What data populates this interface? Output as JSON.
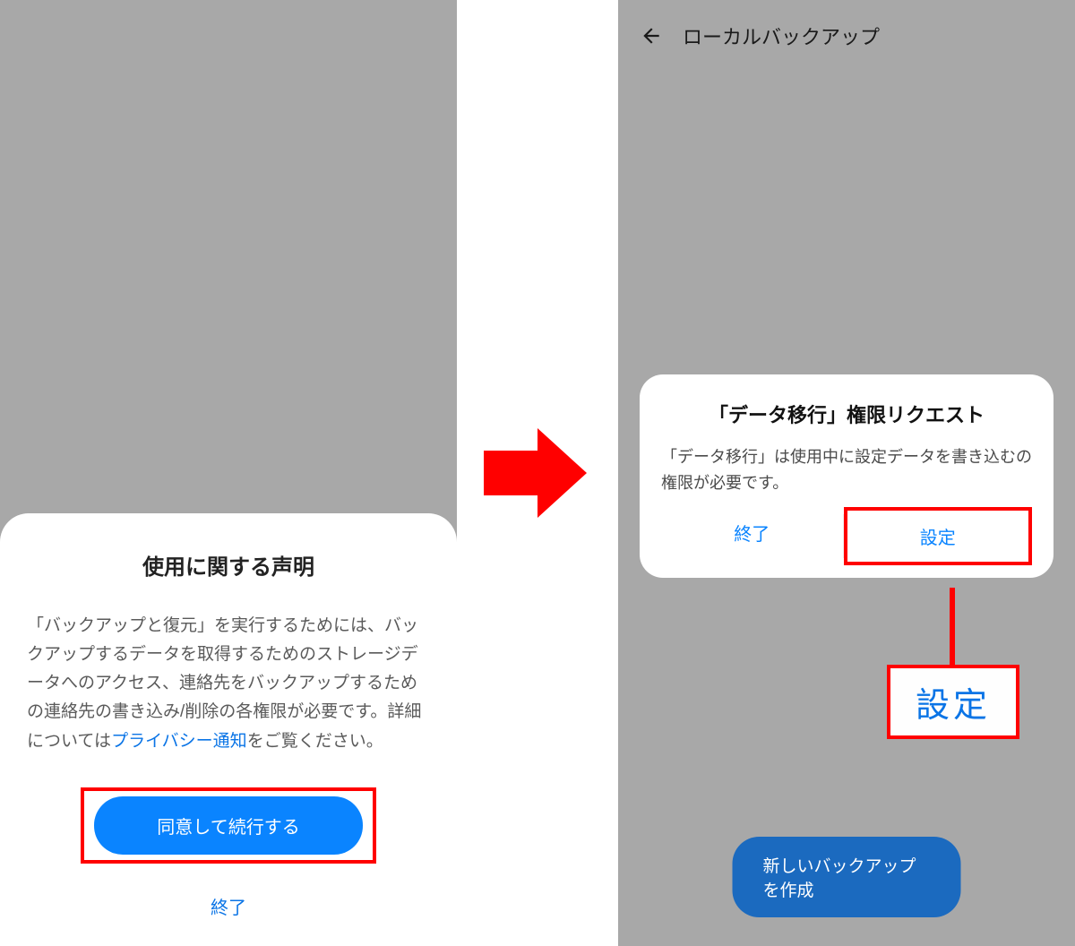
{
  "left": {
    "sheet_title": "使用に関する声明",
    "sheet_body_prefix": "「バックアップと復元」を実行するためには、バックアップするデータを取得するためのストレージデータへのアクセス、連絡先をバックアップするための連絡先の書き込み/削除の各権限が必要です。詳細については",
    "sheet_body_link": "プライバシー通知",
    "sheet_body_suffix": "をご覧ください。",
    "agree_label": "同意して続行する",
    "exit_label": "終了"
  },
  "right": {
    "header_title": "ローカルバックアップ",
    "dialog_title": "「データ移行」権限リクエスト",
    "dialog_body": "「データ移行」は使用中に設定データを書き込むの権限が必要です。",
    "exit_label": "終了",
    "settings_label": "設定",
    "callout_label": "設定",
    "create_backup_label": "新しいバックアップを作成"
  }
}
